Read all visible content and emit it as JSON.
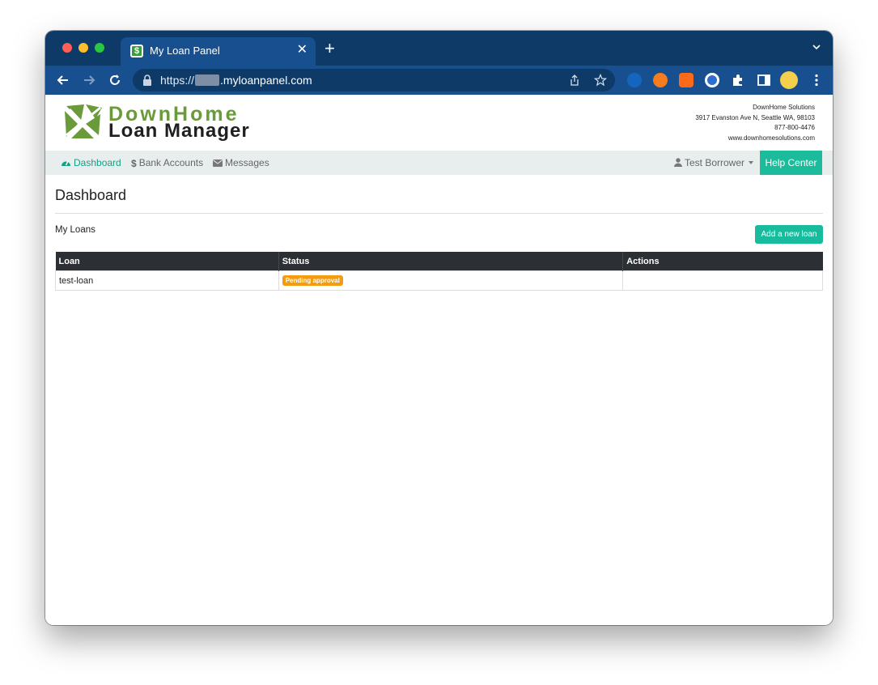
{
  "browser": {
    "tab_title": "My Loan Panel",
    "url_prefix": "https://",
    "url_host": ".myloanpanel.com"
  },
  "logo": {
    "line1": "DownHome",
    "line2": "Loan Manager"
  },
  "company": {
    "name": "DownHome Solutions",
    "address": "3917 Evanston Ave N, Seattle WA, 98103",
    "phone": "877-800-4476",
    "website": "www.downhomesolutions.com"
  },
  "nav": {
    "dashboard": "Dashboard",
    "bank_accounts": "Bank Accounts",
    "messages": "Messages",
    "user": "Test Borrower",
    "help": "Help Center"
  },
  "main": {
    "title": "Dashboard",
    "section": "My Loans",
    "add_button": "Add a new loan",
    "table": {
      "headers": [
        "Loan",
        "Status",
        "Actions"
      ],
      "rows": [
        {
          "loan": "test-loan",
          "status": "Pending approval",
          "actions": ""
        }
      ]
    }
  },
  "colors": {
    "browser_frame": "#0e3a68",
    "browser_toolbar": "#18508f",
    "accent": "#1abc9c",
    "active_nav": "#16a085",
    "badge_pending": "#f39c12",
    "logo_green": "#6a9a3a",
    "table_header": "#2c3035"
  },
  "icons": {
    "dashboard": "tachometer-icon",
    "bank_accounts": "dollar-icon",
    "messages": "envelope-icon",
    "user": "user-icon"
  }
}
